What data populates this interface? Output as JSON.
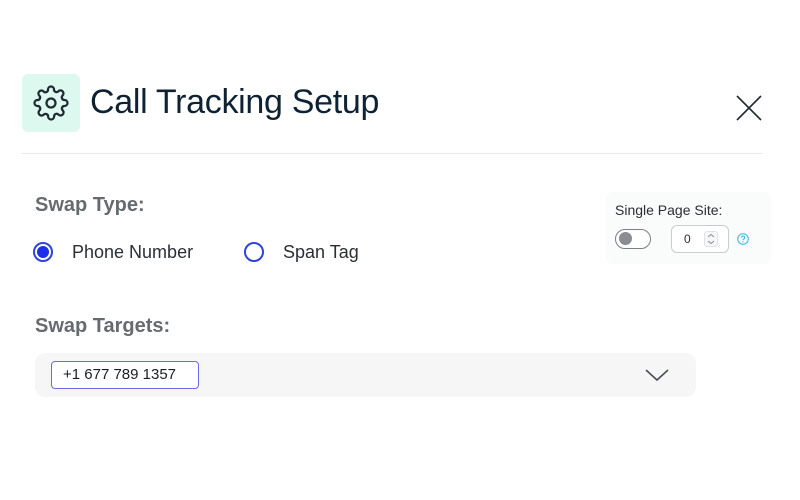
{
  "header": {
    "title": "Call Tracking Setup",
    "icon": "gear-icon",
    "icon_bg_color": "#ddf8ef"
  },
  "swap_type": {
    "label": "Swap Type:",
    "options": [
      {
        "label": "Phone Number",
        "selected": true
      },
      {
        "label": "Span Tag",
        "selected": false
      }
    ]
  },
  "single_page_site": {
    "label": "Single Page Site:",
    "toggle_on": false,
    "value": "0"
  },
  "swap_targets": {
    "label": "Swap Targets:",
    "selected": [
      "+1 677 789 1357"
    ]
  },
  "colors": {
    "accent": "#1c2ee8",
    "title": "#0f2233",
    "label": "#666b70"
  }
}
